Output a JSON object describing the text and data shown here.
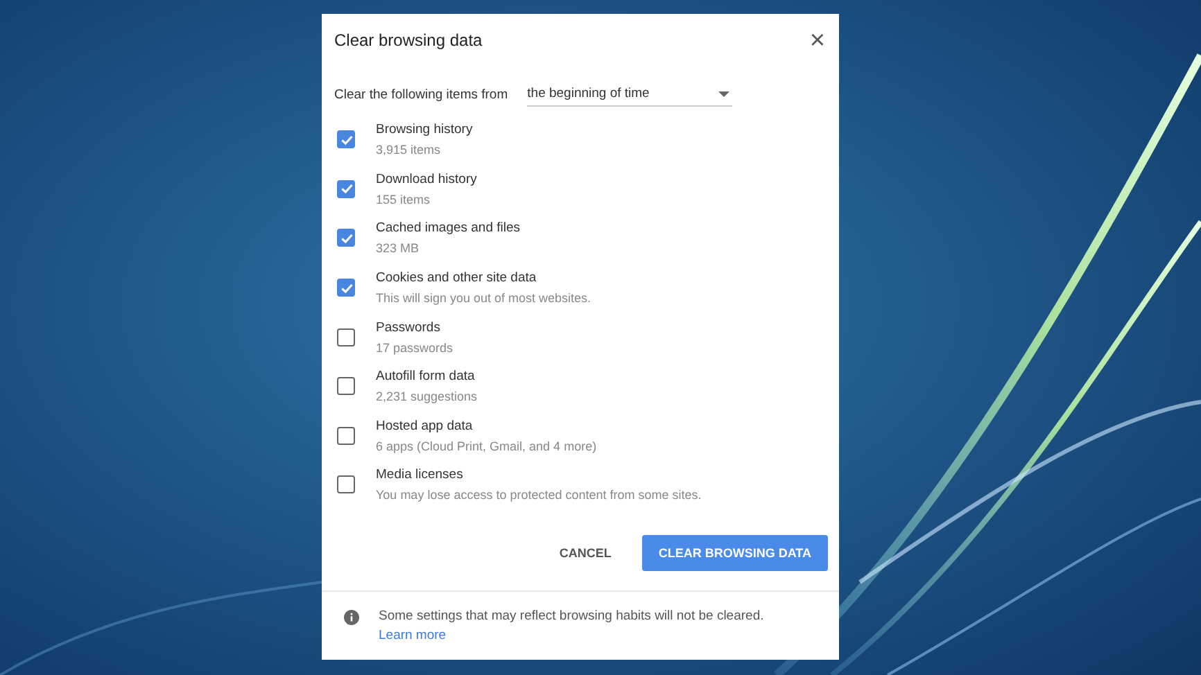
{
  "dialog": {
    "title": "Clear browsing data",
    "close": "×"
  },
  "range": {
    "label": "Clear the following items from",
    "value": "the beginning of time"
  },
  "items": [
    {
      "label": "Browsing history",
      "detail": "3,915 items",
      "checked": true
    },
    {
      "label": "Download history",
      "detail": "155 items",
      "checked": true
    },
    {
      "label": "Cached images and files",
      "detail": "323 MB",
      "checked": true
    },
    {
      "label": "Cookies and other site data",
      "detail": "This will sign you out of most websites.",
      "checked": true
    },
    {
      "label": "Passwords",
      "detail": "17 passwords",
      "checked": false
    },
    {
      "label": "Autofill form data",
      "detail": "2,231 suggestions",
      "checked": false
    },
    {
      "label": "Hosted app data",
      "detail": "6 apps (Cloud Print, Gmail, and 4 more)",
      "checked": false
    },
    {
      "label": "Media licenses",
      "detail": "You may lose access to protected content from some sites.",
      "checked": false
    }
  ],
  "buttons": {
    "cancel": "CANCEL",
    "confirm": "CLEAR BROWSING DATA"
  },
  "footer": {
    "text": "Some settings that may reflect browsing habits will not be cleared.",
    "link": "Learn more"
  }
}
